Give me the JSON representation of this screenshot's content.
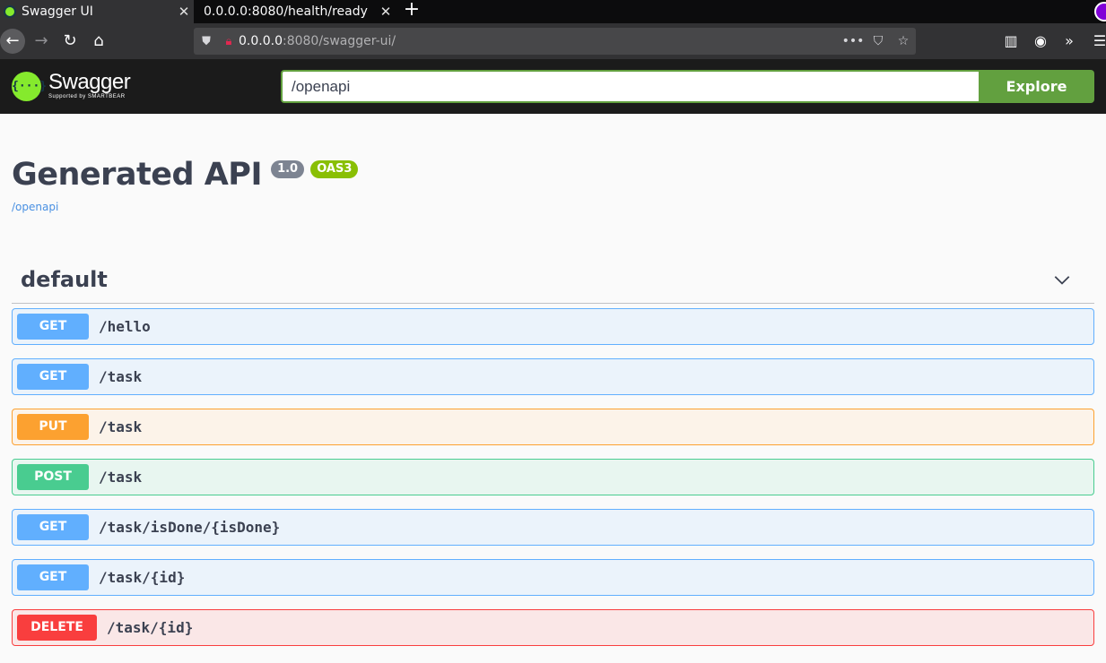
{
  "browser": {
    "tabs": [
      {
        "title": "Swagger UI",
        "active": true
      },
      {
        "title": "0.0.0.0:8080/health/ready",
        "active": false
      }
    ],
    "close_glyph": "✕",
    "newtab_glyph": "+",
    "nav": {
      "back": "←",
      "forward": "→",
      "reload": "↻",
      "home": "⌂"
    },
    "url_host": "0.0.0.0",
    "url_rest": ":8080/swagger-ui/",
    "url_actions": {
      "more": "•••",
      "pocket": "⛉",
      "bookmark": "☆"
    },
    "tools": {
      "library": "▥",
      "account": "◉",
      "overflow": "»",
      "menu": "☰"
    }
  },
  "topbar": {
    "logo_glyph": "{···}",
    "logo_name": "Swagger",
    "logo_sub": "Supported by SMARTBEAR",
    "search_value": "/openapi",
    "explore_label": "Explore",
    "accent": "#62a03f"
  },
  "info": {
    "title": "Generated API",
    "version": "1.0",
    "oas": "OAS3",
    "spec_url": "/openapi"
  },
  "tag": {
    "name": "default",
    "collapsed": false
  },
  "operations": [
    {
      "method": "GET",
      "path": "/hello"
    },
    {
      "method": "GET",
      "path": "/task"
    },
    {
      "method": "PUT",
      "path": "/task"
    },
    {
      "method": "POST",
      "path": "/task"
    },
    {
      "method": "GET",
      "path": "/task/isDone/{isDone}"
    },
    {
      "method": "GET",
      "path": "/task/{id}"
    },
    {
      "method": "DELETE",
      "path": "/task/{id}"
    }
  ],
  "colors": {
    "get": "#61affe",
    "put": "#fca130",
    "post": "#49cc90",
    "delete": "#f93e3e"
  }
}
